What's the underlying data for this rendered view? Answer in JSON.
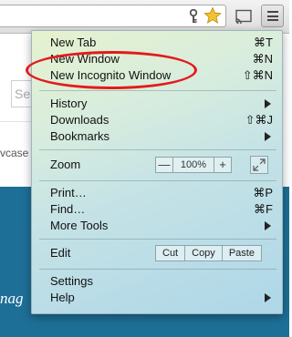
{
  "toolbar": {
    "icons": [
      "key-icon",
      "star-icon",
      "cast-icon",
      "hamburger-menu-icon"
    ],
    "star_color": "#f2c230"
  },
  "page": {
    "search_fragment": "Se",
    "text_fragment": "vcase",
    "band_fragment": "nag",
    "band_color": "#1e6f97"
  },
  "menu": {
    "new_tab": {
      "label": "New Tab",
      "shortcut": "⌘T"
    },
    "new_window": {
      "label": "New Window",
      "shortcut": "⌘N"
    },
    "new_incognito": {
      "label": "New Incognito Window",
      "shortcut": "⇧⌘N"
    },
    "history": {
      "label": "History"
    },
    "downloads": {
      "label": "Downloads",
      "shortcut": "⇧⌘J"
    },
    "bookmarks": {
      "label": "Bookmarks"
    },
    "zoom": {
      "label": "Zoom",
      "minus": "—",
      "value": "100%",
      "plus": "+"
    },
    "print": {
      "label": "Print…",
      "shortcut": "⌘P"
    },
    "find": {
      "label": "Find…",
      "shortcut": "⌘F"
    },
    "more_tools": {
      "label": "More Tools"
    },
    "edit": {
      "label": "Edit",
      "cut": "Cut",
      "copy": "Copy",
      "paste": "Paste"
    },
    "settings": {
      "label": "Settings"
    },
    "help": {
      "label": "Help"
    }
  },
  "annotation": {
    "color": "#e31b1b"
  }
}
